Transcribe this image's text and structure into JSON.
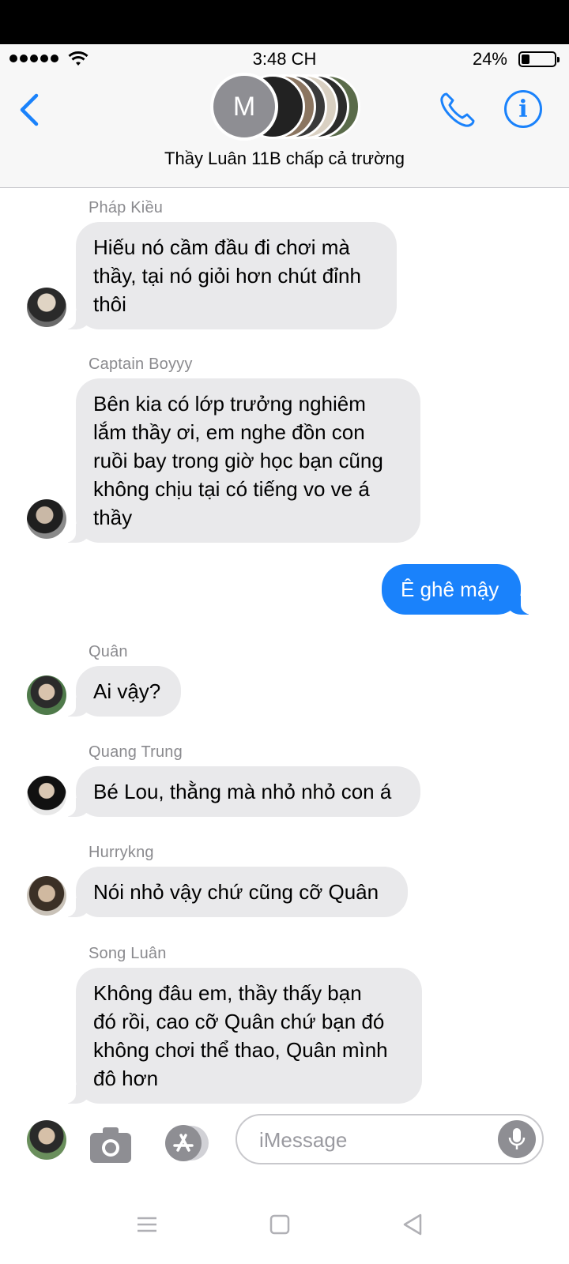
{
  "status_bar": {
    "time": "3:48 CH",
    "battery_percent": "24%",
    "battery_level": 0.24
  },
  "header": {
    "avatar_initial": "M",
    "group_name": "Thầy Luân 11B chấp cả trường"
  },
  "messages": [
    {
      "sender": "Pháp Kiều",
      "direction": "incoming",
      "lines": [
        "Hiếu nó cầm đầu đi chơi mà",
        "thầy, tại nó giỏi hơn chút đỉnh",
        "thôi"
      ]
    },
    {
      "sender": "Captain Boyyy",
      "direction": "incoming",
      "lines": [
        "Bên kia có lớp trưởng nghiêm",
        "lắm thầy ơi, em nghe đồn con",
        "ruồi bay trong giờ học bạn cũng",
        "không chịu tại có tiếng vo ve á",
        "thầy"
      ]
    },
    {
      "sender": "",
      "direction": "outgoing",
      "lines": [
        "Ê ghê mậy"
      ]
    },
    {
      "sender": "Quân",
      "direction": "incoming",
      "lines": [
        "Ai vậy?"
      ]
    },
    {
      "sender": "Quang Trung",
      "direction": "incoming",
      "lines": [
        "Bé Lou, thằng mà nhỏ nhỏ con á"
      ]
    },
    {
      "sender": "Hurrykng",
      "direction": "incoming",
      "lines": [
        "Nói nhỏ vậy chứ cũng cỡ Quân"
      ]
    },
    {
      "sender": "Song Luân",
      "direction": "incoming",
      "lines": [
        "Không đâu em, thầy thấy bạn",
        "đó rồi, cao cỡ Quân chứ bạn đó",
        "không chơi thể thao, Quân mình",
        "đô hơn"
      ]
    }
  ],
  "composer": {
    "placeholder": "iMessage"
  },
  "colors": {
    "accent": "#1a82fb",
    "incoming_bubble": "#e9e9eb",
    "header_bg": "#f7f7f7"
  }
}
